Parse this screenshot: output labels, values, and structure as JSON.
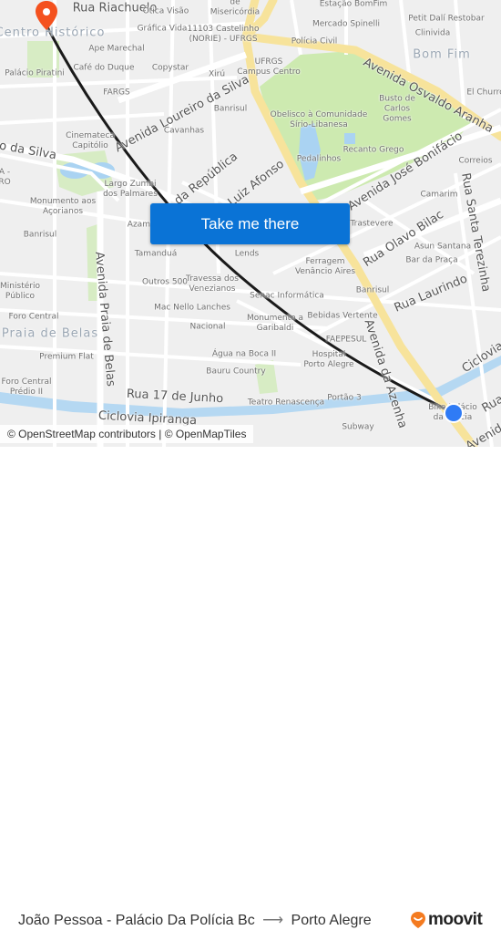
{
  "map": {
    "attribution": "© OpenStreetMap contributors | © OpenMapTiles",
    "action_button": "Take me there",
    "origin_marker": "destination-pin",
    "current_location": "origin-dot",
    "colors": {
      "route": "#1a1a1a",
      "pin": "#f4511e",
      "dot": "#2f7bf5",
      "button": "#0a73d6",
      "park": "#cdeab0",
      "water": "#aad3f2",
      "major_road": "#f7e39b"
    },
    "labels": {
      "streets": [
        "Rua Riachuelo",
        "Avenida Osvaldo Aranha",
        "Avenida Loureiro da Silva",
        "ro da Silva",
        "Avenida José Bonifácio",
        "Rua da República",
        "Rua Luiz Afonso",
        "Rua Olavo Bilac",
        "Rua Santa Terezinha",
        "Rua Laurindo",
        "Avenida Praia de Belas",
        "Rua 17 de Junho",
        "Ciclovia Ipiranga",
        "Ciclovia",
        "Avenida da Azenha",
        "Rua",
        "Avenida"
      ],
      "districts": [
        "Centro Histórico",
        "Bom Fim",
        "Praia de Belas"
      ],
      "places": [
        "Ótica Visão",
        "Santa Casa de Misericórdia",
        "Estação BomFim",
        "Gráfica Vida",
        "11103 Castelinho (NORIE) - UFRGS",
        "Mercado Spinelli",
        "Petit Dalí Restobar",
        "Clinivida",
        "Ape Marechal",
        "Polícia Civil",
        "Palácio Piratini",
        "Café do Duque",
        "Copystar",
        "Xirú",
        "UFRGS Campus Centro",
        "FARGS",
        "El Churro",
        "Banrisul",
        "Obelisco à Comunidade Sírio-Libanesa",
        "Busto de Carlos Gomes",
        "Cinemateca Capitólio",
        "Cavanhas",
        "Recanto Grego",
        "Pedalinhos",
        "Correios",
        "Largo Zumbi dos Palmares",
        "Monumento aos Açorianos",
        "Camarim",
        "Azamba",
        "Trastevere",
        "Banrisul",
        "Asun Santana",
        "Tamanduá",
        "Lends",
        "Ferragem Venâncio Aires",
        "Bar da Praça",
        "Ministério Público",
        "Outros 500",
        "Travessa dos Venezianos",
        "Senac Informática",
        "Banrisul",
        "Mac Nello Lanches",
        "Foro Central",
        "Monumento a Garibaldi",
        "Bebidas Vertente",
        "Nacional",
        "FAEPESUL",
        "Premium Flat",
        "Água na Boca II",
        "Hospital Porto Alegre",
        "Bauru Country",
        "Foro Central Prédio II",
        "Portão 3",
        "Teatro Renascença",
        "Bike Palácio da Polícia",
        "Subway",
        "A - RO"
      ]
    }
  },
  "footer": {
    "origin": "João Pessoa - Palácio Da Polícia Bc",
    "arrow": "⟶",
    "destination": "Porto Alegre",
    "brand": "moovit"
  }
}
